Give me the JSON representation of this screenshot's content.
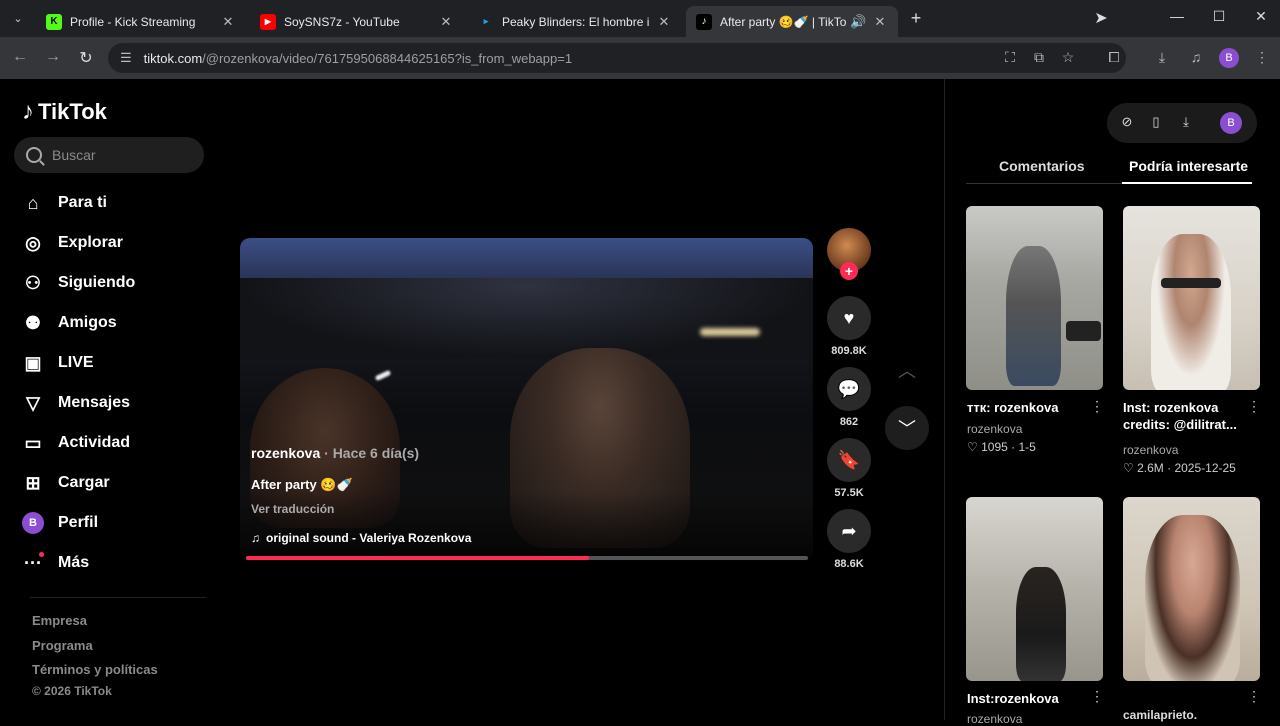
{
  "browser": {
    "tabs": [
      {
        "title": "Profile - Kick Streaming",
        "icon": "kick-icon",
        "active": false
      },
      {
        "title": "SoySNS7z - YouTube",
        "icon": "youtube-icon",
        "active": false
      },
      {
        "title": "Peaky Blinders: El hombre inmo",
        "icon": "prime-video-icon",
        "active": false
      },
      {
        "title": "After party 🥴🍼 | TikTok",
        "icon": "tiktok-icon",
        "active": true
      }
    ],
    "url_host": "tiktok.com",
    "url_path": "/@rozenkova/video/7617595068844625165?is_from_webapp=1",
    "profile_initial": "B"
  },
  "sidebar": {
    "logo": "TikTok",
    "search_placeholder": "Buscar",
    "items": [
      {
        "label": "Para ti",
        "icon": "home-icon"
      },
      {
        "label": "Explorar",
        "icon": "compass-icon"
      },
      {
        "label": "Siguiendo",
        "icon": "following-icon"
      },
      {
        "label": "Amigos",
        "icon": "friends-icon"
      },
      {
        "label": "LIVE",
        "icon": "live-icon"
      },
      {
        "label": "Mensajes",
        "icon": "messages-icon"
      },
      {
        "label": "Actividad",
        "icon": "activity-icon"
      },
      {
        "label": "Cargar",
        "icon": "upload-icon"
      },
      {
        "label": "Perfil",
        "icon": "profile-avatar"
      },
      {
        "label": "Más",
        "icon": "more-icon"
      }
    ],
    "profile_initial": "B",
    "footer": [
      "Empresa",
      "Programa",
      "Términos y políticas"
    ],
    "copyright": "© 2026 TikTok"
  },
  "video": {
    "author": "rozenkova",
    "time_ago": " · Hace 6 día(s)",
    "caption": "After party 🥴🍼",
    "translate": "Ver traducción",
    "sound": "original sound - Valeriya Rozenkova",
    "progress": 0.61
  },
  "actions": {
    "likes": "809.8K",
    "comments": "862",
    "saves": "57.5K",
    "shares": "88.6K"
  },
  "right_panel": {
    "tabs": [
      "Comentarios",
      "Podría interesarte"
    ],
    "selected_tab": "Podría interesarte",
    "cards": [
      {
        "title": "ттк: rozenkova",
        "user": "rozenkova",
        "likes": "♡ 1095",
        "date": "1-5"
      },
      {
        "title": "Inst: rozenkova credits: @dilitrat...",
        "user": "rozenkova",
        "likes": "♡ 2.6M",
        "date": "2025-12-25"
      },
      {
        "title": "Inst:rozenkova",
        "user": "rozenkova"
      },
      {
        "title": "",
        "user": "camilaprieto."
      }
    ]
  },
  "colors": {
    "accent": "#fe2c55",
    "avatar": "#8a4ed0"
  }
}
